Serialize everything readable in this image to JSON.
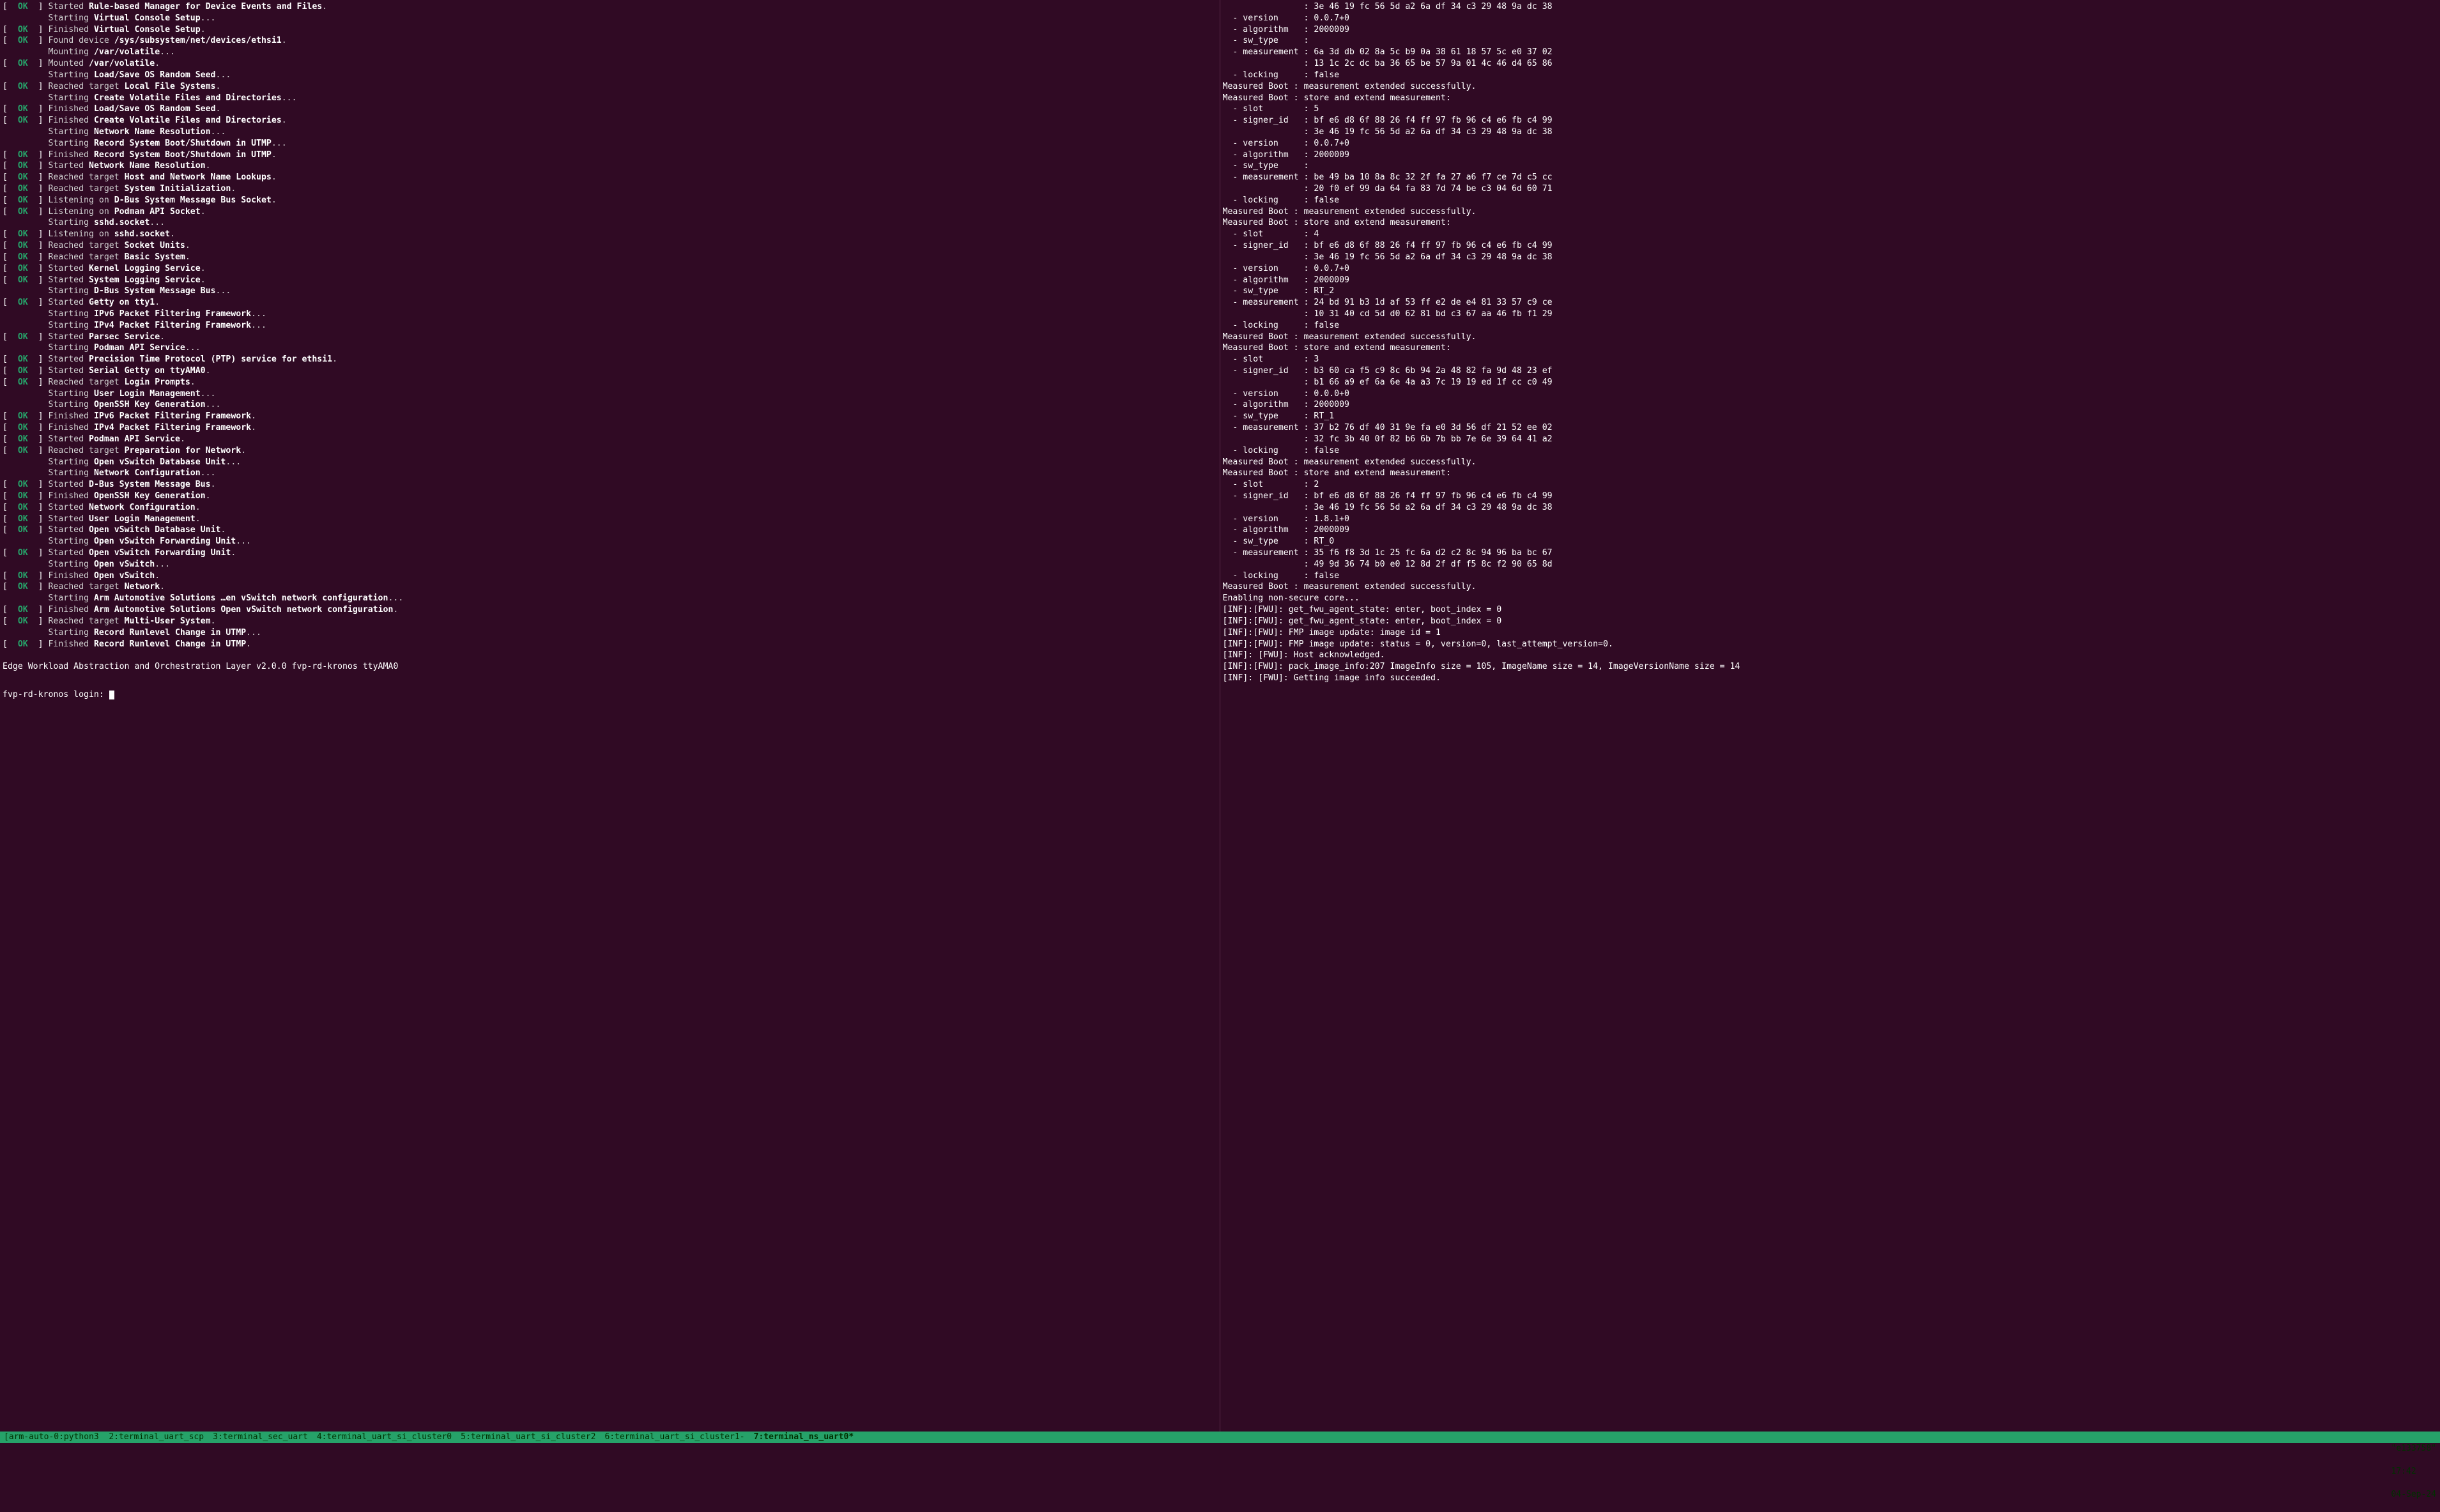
{
  "left": [
    {
      "status": "OK",
      "verb": "Started",
      "bold": "Rule-based Manager for Device Events and Files",
      "suffix": "."
    },
    {
      "status": "",
      "verb": "Starting",
      "bold": "Virtual Console Setup",
      "suffix": "..."
    },
    {
      "status": "OK",
      "verb": "Finished",
      "bold": "Virtual Console Setup",
      "suffix": "."
    },
    {
      "status": "OK",
      "verb": "Found device",
      "bold": "/sys/subsystem/net/devices/ethsi1",
      "suffix": "."
    },
    {
      "status": "",
      "verb": "Mounting",
      "bold": "/var/volatile",
      "suffix": "..."
    },
    {
      "status": "OK",
      "verb": "Mounted",
      "bold": "/var/volatile",
      "suffix": "."
    },
    {
      "status": "",
      "verb": "Starting",
      "bold": "Load/Save OS Random Seed",
      "suffix": "..."
    },
    {
      "status": "OK",
      "verb": "Reached target",
      "bold": "Local File Systems",
      "suffix": "."
    },
    {
      "status": "",
      "verb": "Starting",
      "bold": "Create Volatile Files and Directories",
      "suffix": "..."
    },
    {
      "status": "OK",
      "verb": "Finished",
      "bold": "Load/Save OS Random Seed",
      "suffix": "."
    },
    {
      "status": "OK",
      "verb": "Finished",
      "bold": "Create Volatile Files and Directories",
      "suffix": "."
    },
    {
      "status": "",
      "verb": "Starting",
      "bold": "Network Name Resolution",
      "suffix": "..."
    },
    {
      "status": "",
      "verb": "Starting",
      "bold": "Record System Boot/Shutdown in UTMP",
      "suffix": "..."
    },
    {
      "status": "OK",
      "verb": "Finished",
      "bold": "Record System Boot/Shutdown in UTMP",
      "suffix": "."
    },
    {
      "status": "OK",
      "verb": "Started",
      "bold": "Network Name Resolution",
      "suffix": "."
    },
    {
      "status": "OK",
      "verb": "Reached target",
      "bold": "Host and Network Name Lookups",
      "suffix": "."
    },
    {
      "status": "OK",
      "verb": "Reached target",
      "bold": "System Initialization",
      "suffix": "."
    },
    {
      "status": "OK",
      "verb": "Listening on",
      "bold": "D-Bus System Message Bus Socket",
      "suffix": "."
    },
    {
      "status": "OK",
      "verb": "Listening on",
      "bold": "Podman API Socket",
      "suffix": "."
    },
    {
      "status": "",
      "verb": "Starting",
      "bold": "sshd.socket",
      "suffix": "..."
    },
    {
      "status": "OK",
      "verb": "Listening on",
      "bold": "sshd.socket",
      "suffix": "."
    },
    {
      "status": "OK",
      "verb": "Reached target",
      "bold": "Socket Units",
      "suffix": "."
    },
    {
      "status": "OK",
      "verb": "Reached target",
      "bold": "Basic System",
      "suffix": "."
    },
    {
      "status": "OK",
      "verb": "Started",
      "bold": "Kernel Logging Service",
      "suffix": "."
    },
    {
      "status": "OK",
      "verb": "Started",
      "bold": "System Logging Service",
      "suffix": "."
    },
    {
      "status": "",
      "verb": "Starting",
      "bold": "D-Bus System Message Bus",
      "suffix": "..."
    },
    {
      "status": "OK",
      "verb": "Started",
      "bold": "Getty on tty1",
      "suffix": "."
    },
    {
      "status": "",
      "verb": "Starting",
      "bold": "IPv6 Packet Filtering Framework",
      "suffix": "..."
    },
    {
      "status": "",
      "verb": "Starting",
      "bold": "IPv4 Packet Filtering Framework",
      "suffix": "..."
    },
    {
      "status": "OK",
      "verb": "Started",
      "bold": "Parsec Service",
      "suffix": "."
    },
    {
      "status": "",
      "verb": "Starting",
      "bold": "Podman API Service",
      "suffix": "..."
    },
    {
      "status": "OK",
      "verb": "Started",
      "bold": "Precision Time Protocol (PTP) service for ethsi1",
      "suffix": "."
    },
    {
      "status": "OK",
      "verb": "Started",
      "bold": "Serial Getty on ttyAMA0",
      "suffix": "."
    },
    {
      "status": "OK",
      "verb": "Reached target",
      "bold": "Login Prompts",
      "suffix": "."
    },
    {
      "status": "",
      "verb": "Starting",
      "bold": "User Login Management",
      "suffix": "..."
    },
    {
      "status": "",
      "verb": "Starting",
      "bold": "OpenSSH Key Generation",
      "suffix": "..."
    },
    {
      "status": "OK",
      "verb": "Finished",
      "bold": "IPv6 Packet Filtering Framework",
      "suffix": "."
    },
    {
      "status": "OK",
      "verb": "Finished",
      "bold": "IPv4 Packet Filtering Framework",
      "suffix": "."
    },
    {
      "status": "OK",
      "verb": "Started",
      "bold": "Podman API Service",
      "suffix": "."
    },
    {
      "status": "OK",
      "verb": "Reached target",
      "bold": "Preparation for Network",
      "suffix": "."
    },
    {
      "status": "",
      "verb": "Starting",
      "bold": "Open vSwitch Database Unit",
      "suffix": "..."
    },
    {
      "status": "",
      "verb": "Starting",
      "bold": "Network Configuration",
      "suffix": "..."
    },
    {
      "status": "OK",
      "verb": "Started",
      "bold": "D-Bus System Message Bus",
      "suffix": "."
    },
    {
      "status": "OK",
      "verb": "Finished",
      "bold": "OpenSSH Key Generation",
      "suffix": "."
    },
    {
      "status": "OK",
      "verb": "Started",
      "bold": "Network Configuration",
      "suffix": "."
    },
    {
      "status": "OK",
      "verb": "Started",
      "bold": "User Login Management",
      "suffix": "."
    },
    {
      "status": "OK",
      "verb": "Started",
      "bold": "Open vSwitch Database Unit",
      "suffix": "."
    },
    {
      "status": "",
      "verb": "Starting",
      "bold": "Open vSwitch Forwarding Unit",
      "suffix": "..."
    },
    {
      "status": "OK",
      "verb": "Started",
      "bold": "Open vSwitch Forwarding Unit",
      "suffix": "."
    },
    {
      "status": "",
      "verb": "Starting",
      "bold": "Open vSwitch",
      "suffix": "..."
    },
    {
      "status": "OK",
      "verb": "Finished",
      "bold": "Open vSwitch",
      "suffix": "."
    },
    {
      "status": "OK",
      "verb": "Reached target",
      "bold": "Network",
      "suffix": "."
    },
    {
      "status": "",
      "verb": "Starting",
      "bold": "Arm Automotive Solutions …en vSwitch network configuration",
      "suffix": "..."
    },
    {
      "status": "OK",
      "verb": "Finished",
      "bold": "Arm Automotive Solutions Open vSwitch network configuration",
      "suffix": "."
    },
    {
      "status": "OK",
      "verb": "Reached target",
      "bold": "Multi-User System",
      "suffix": "."
    },
    {
      "status": "",
      "verb": "Starting",
      "bold": "Record Runlevel Change in UTMP",
      "suffix": "..."
    },
    {
      "status": "OK",
      "verb": "Finished",
      "bold": "Record Runlevel Change in UTMP",
      "suffix": "."
    }
  ],
  "left_footer": {
    "banner": "Edge Workload Abstraction and Orchestration Layer v2.0.0 fvp-rd-kronos ttyAMA0",
    "login": "fvp-rd-kronos login: "
  },
  "right": [
    "                : 3e 46 19 fc 56 5d a2 6a df 34 c3 29 48 9a dc 38",
    "  - version     : 0.0.7+0",
    "  - algorithm   : 2000009",
    "  - sw_type     :",
    "  - measurement : 6a 3d db 02 8a 5c b9 0a 38 61 18 57 5c e0 37 02",
    "                : 13 1c 2c dc ba 36 65 be 57 9a 01 4c 46 d4 65 86",
    "  - locking     : false",
    "Measured Boot : measurement extended successfully.",
    "Measured Boot : store and extend measurement:",
    "  - slot        : 5",
    "  - signer_id   : bf e6 d8 6f 88 26 f4 ff 97 fb 96 c4 e6 fb c4 99",
    "                : 3e 46 19 fc 56 5d a2 6a df 34 c3 29 48 9a dc 38",
    "  - version     : 0.0.7+0",
    "  - algorithm   : 2000009",
    "  - sw_type     :",
    "  - measurement : be 49 ba 10 8a 8c 32 2f fa 27 a6 f7 ce 7d c5 cc",
    "                : 20 f0 ef 99 da 64 fa 83 7d 74 be c3 04 6d 60 71",
    "  - locking     : false",
    "Measured Boot : measurement extended successfully.",
    "Measured Boot : store and extend measurement:",
    "  - slot        : 4",
    "  - signer_id   : bf e6 d8 6f 88 26 f4 ff 97 fb 96 c4 e6 fb c4 99",
    "                : 3e 46 19 fc 56 5d a2 6a df 34 c3 29 48 9a dc 38",
    "  - version     : 0.0.7+0",
    "  - algorithm   : 2000009",
    "  - sw_type     : RT_2",
    "  - measurement : 24 bd 91 b3 1d af 53 ff e2 de e4 81 33 57 c9 ce",
    "                : 10 31 40 cd 5d d0 62 81 bd c3 67 aa 46 fb f1 29",
    "  - locking     : false",
    "Measured Boot : measurement extended successfully.",
    "Measured Boot : store and extend measurement:",
    "  - slot        : 3",
    "  - signer_id   : b3 60 ca f5 c9 8c 6b 94 2a 48 82 fa 9d 48 23 ef",
    "                : b1 66 a9 ef 6a 6e 4a a3 7c 19 19 ed 1f cc c0 49",
    "  - version     : 0.0.0+0",
    "  - algorithm   : 2000009",
    "  - sw_type     : RT_1",
    "  - measurement : 37 b2 76 df 40 31 9e fa e0 3d 56 df 21 52 ee 02",
    "                : 32 fc 3b 40 0f 82 b6 6b 7b bb 7e 6e 39 64 41 a2",
    "  - locking     : false",
    "Measured Boot : measurement extended successfully.",
    "Measured Boot : store and extend measurement:",
    "  - slot        : 2",
    "  - signer_id   : bf e6 d8 6f 88 26 f4 ff 97 fb 96 c4 e6 fb c4 99",
    "                : 3e 46 19 fc 56 5d a2 6a df 34 c3 29 48 9a dc 38",
    "  - version     : 1.8.1+0",
    "  - algorithm   : 2000009",
    "  - sw_type     : RT_0",
    "  - measurement : 35 f6 f8 3d 1c 25 fc 6a d2 c2 8c 94 96 ba bc 67",
    "                : 49 9d 36 74 b0 e0 12 8d 2f df f5 8c f2 90 65 8d",
    "  - locking     : false",
    "Measured Boot : measurement extended successfully.",
    "Enabling non-secure core...",
    "[INF]:[FWU]: get_fwu_agent_state: enter, boot_index = 0",
    "[INF]:[FWU]: get_fwu_agent_state: enter, boot_index = 0",
    "[INF]:[FWU]: FMP image update: image id = 1",
    "[INF]:[FWU]: FMP image update: status = 0, version=0, last_attempt_version=0.",
    "[INF]: [FWU]: Host acknowledged.",
    "[INF]:[FWU]: pack_image_info:207 ImageInfo size = 105, ImageName size = 14, ImageVersionName size = 14",
    "[INF]: [FWU]: Getting image info succeeded."
  ],
  "statusbar": {
    "session": "[arm-auto-0:python3",
    "tabs": [
      {
        "id": "2",
        "name": "terminal_uart_scp",
        "active": false
      },
      {
        "id": "3",
        "name": "terminal_sec_uart",
        "active": false
      },
      {
        "id": "4",
        "name": "terminal_uart_si_cluster0",
        "active": false
      },
      {
        "id": "5",
        "name": "terminal_uart_si_cluster2",
        "active": false
      },
      {
        "id": "6",
        "name": "terminal_uart_si_cluster1-",
        "active": false
      },
      {
        "id": "7",
        "name": "terminal_ns_uart0*",
        "active": true
      }
    ],
    "host": "\"e133758\"",
    "time": "17:42",
    "date": "04-Sep-24"
  }
}
